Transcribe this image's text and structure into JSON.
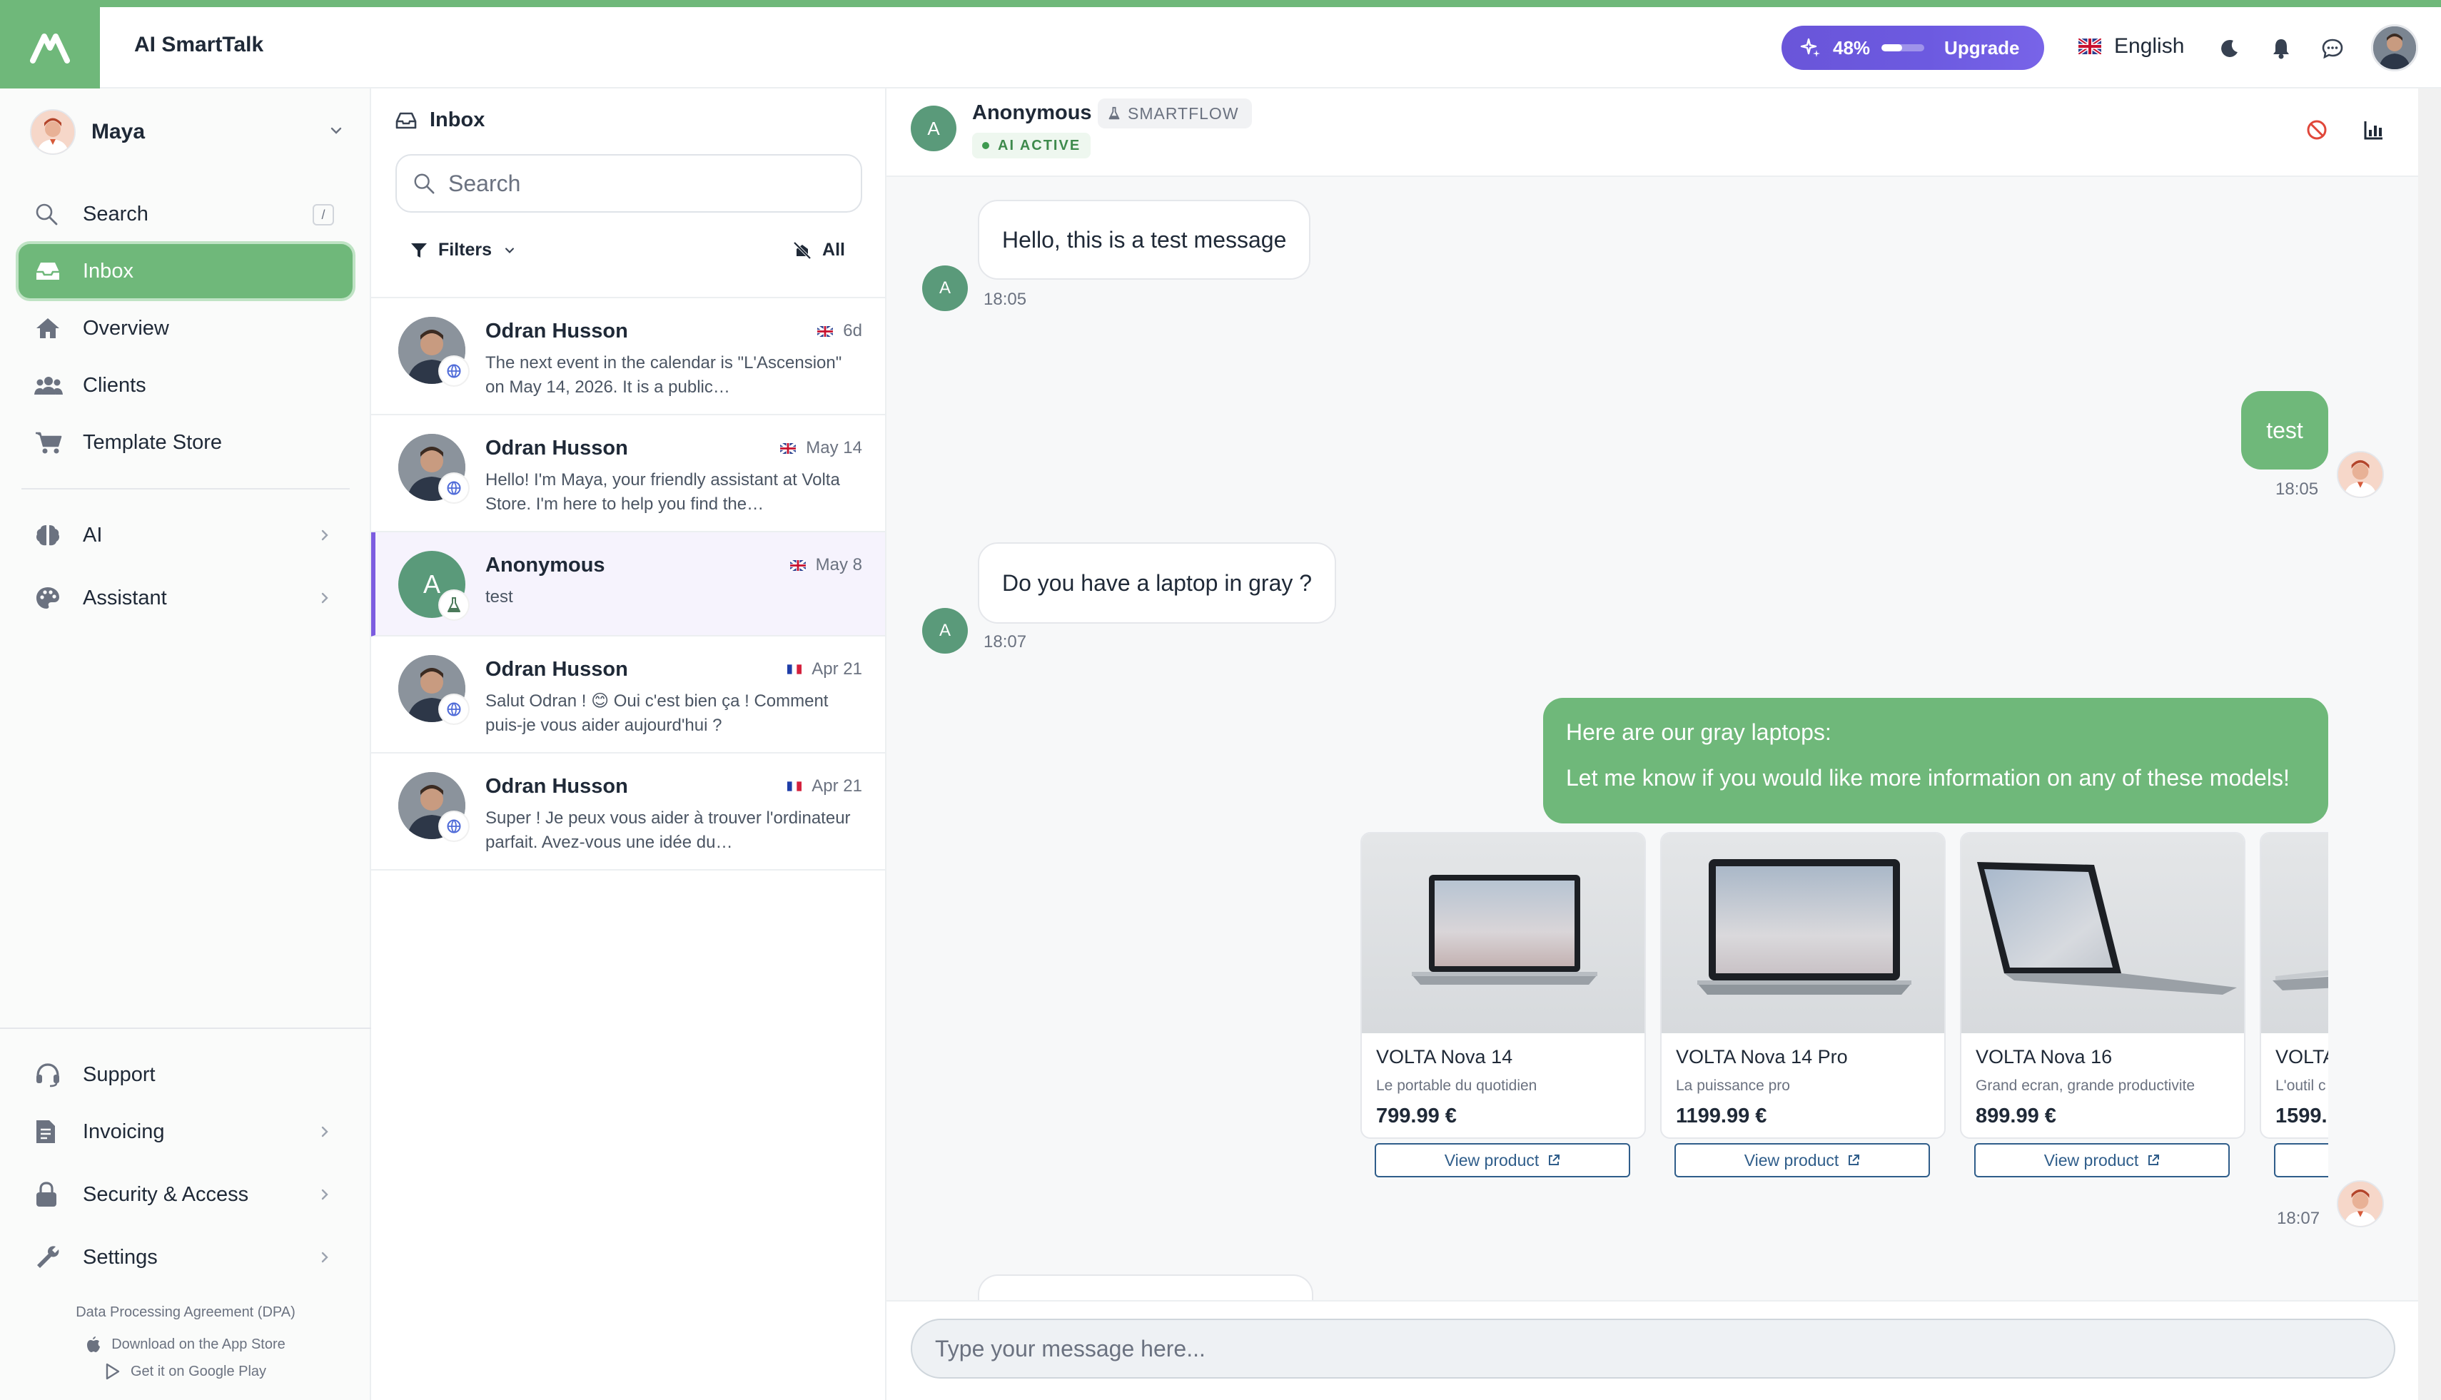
{
  "header": {
    "app_title": "AI SmartTalk",
    "usage_percent": "48%",
    "usage_fraction": 0.48,
    "upgrade_label": "Upgrade",
    "language": "English",
    "icons": [
      "moon-icon",
      "bell-icon",
      "chat-bubble-icon",
      "user-avatar"
    ]
  },
  "sidebar": {
    "user_name": "Maya",
    "search_label": "Search",
    "search_shortcut": "/",
    "items": [
      {
        "label": "Inbox",
        "icon": "inbox-icon",
        "active": true
      },
      {
        "label": "Overview",
        "icon": "home-icon"
      },
      {
        "label": "Clients",
        "icon": "users-icon"
      },
      {
        "label": "Template Store",
        "icon": "cart-icon"
      }
    ],
    "groups": [
      {
        "label": "AI",
        "icon": "brain-icon"
      },
      {
        "label": "Assistant",
        "icon": "palette-icon"
      }
    ],
    "bottom_items": [
      {
        "label": "Support",
        "icon": "headset-icon"
      },
      {
        "label": "Invoicing",
        "icon": "invoice-icon"
      },
      {
        "label": "Security & Access",
        "icon": "lock-icon"
      },
      {
        "label": "Settings",
        "icon": "wrench-icon"
      }
    ],
    "dpa": "Data Processing Agreement (DPA)",
    "app_store": "Download on the App Store",
    "google_play": "Get it on Google Play"
  },
  "inbox": {
    "title": "Inbox",
    "search_placeholder": "Search",
    "filters_label": "Filters",
    "all_label": "All",
    "conversations": [
      {
        "name": "Odran Husson",
        "time": "6d",
        "flag": "uk",
        "preview": "The next event in the calendar is \"L'Ascension\" on May 14, 2026. It is a public…",
        "badge": "globe-icon"
      },
      {
        "name": "Odran Husson",
        "time": "May 14",
        "flag": "uk",
        "preview": "Hello! I'm Maya, your friendly assistant at Volta Store. I'm here to help you find the…",
        "badge": "globe-icon"
      },
      {
        "name": "Anonymous",
        "time": "May 8",
        "flag": "uk",
        "preview": "test",
        "badge": "flask-icon",
        "initial": "A",
        "selected": true
      },
      {
        "name": "Odran Husson",
        "time": "Apr 21",
        "flag": "fr",
        "preview": "Salut Odran ! 😊 Oui c'est bien ça ! Comment puis-je vous aider aujourd'hui ?",
        "badge": "globe-icon"
      },
      {
        "name": "Odran Husson",
        "time": "Apr 21",
        "flag": "fr",
        "preview": "Super ! Je peux vous aider à trouver l'ordinateur parfait. Avez-vous une idée du…",
        "badge": "globe-icon"
      }
    ]
  },
  "chat": {
    "contact_name": "Anonymous",
    "contact_initial": "A",
    "flow_tag": "SMARTFLOW",
    "status": "AI ACTIVE",
    "messages": [
      {
        "from": "in",
        "text": "Hello, this is a test message",
        "time": "18:05"
      },
      {
        "from": "out",
        "text": "test",
        "time": "18:05"
      },
      {
        "from": "in",
        "text": "Do you have a laptop in gray ?",
        "time": "18:07"
      },
      {
        "from": "out",
        "lines": [
          "Here are our gray laptops:",
          "Let me know if you would like more information on any of these models!"
        ],
        "time": "18:07"
      }
    ],
    "products": [
      {
        "name": "VOLTA Nova 14",
        "subtitle": "Le portable du quotidien",
        "price": "799.99 €",
        "button": "View product"
      },
      {
        "name": "VOLTA Nova 14 Pro",
        "subtitle": "La puissance pro",
        "price": "1199.99 €",
        "button": "View product"
      },
      {
        "name": "VOLTA Nova 16",
        "subtitle": "Grand ecran, grande productivite",
        "price": "899.99 €",
        "button": "View product"
      },
      {
        "name": "VOLTA",
        "subtitle": "L'outil c",
        "price": "1599.",
        "button": ""
      }
    ],
    "composer_placeholder": "Type your message here..."
  },
  "colors": {
    "brand_green": "#6fb87a",
    "upgrade_purple": "#6a55d9",
    "selected_accent": "#7c5ce0",
    "link_blue": "#2f5d8a"
  }
}
